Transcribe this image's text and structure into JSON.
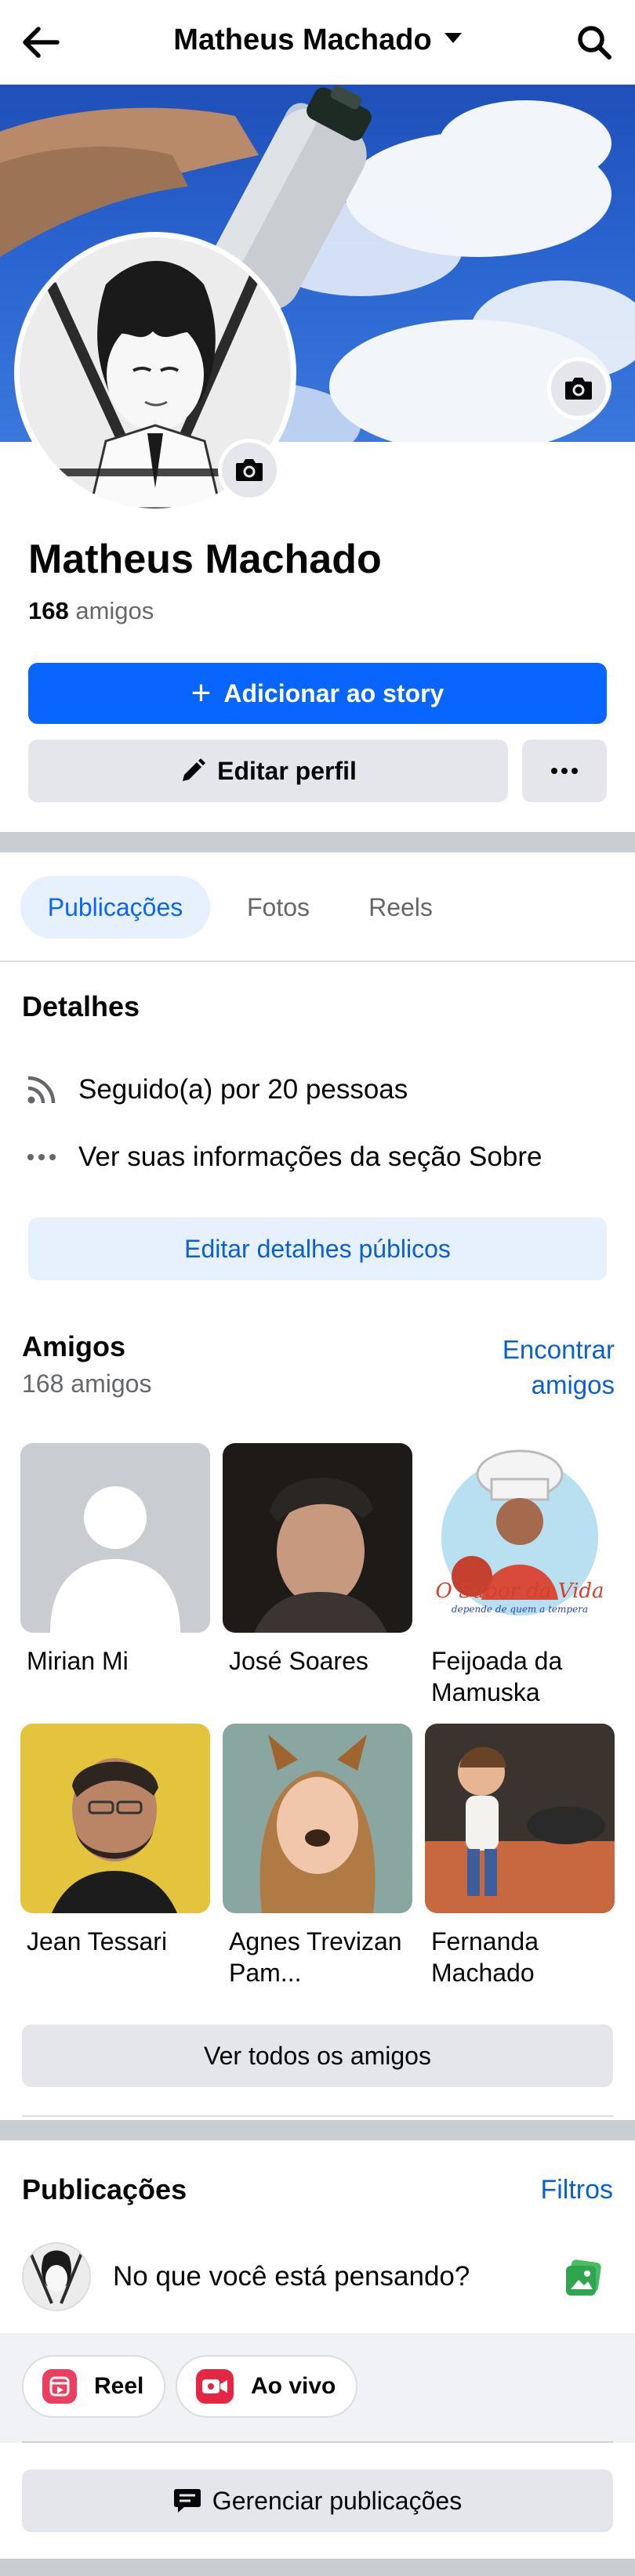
{
  "header": {
    "title": "Matheus Machado",
    "back_icon": "arrow-left-icon",
    "search_icon": "search-icon"
  },
  "profile": {
    "name": "Matheus Machado",
    "friends_number": "168",
    "friends_word": "amigos",
    "add_story_label": "Adicionar ao story",
    "edit_profile_label": "Editar perfil"
  },
  "tabs": [
    {
      "label": "Publicações",
      "active": true
    },
    {
      "label": "Fotos",
      "active": false
    },
    {
      "label": "Reels",
      "active": false
    }
  ],
  "details": {
    "heading": "Detalhes",
    "followed_by": "Seguido(a) por 20 pessoas",
    "about_info": "Ver suas informações da seção Sobre",
    "edit_details_label": "Editar detalhes públicos"
  },
  "friends": {
    "heading": "Amigos",
    "count_label": "168 amigos",
    "find_label": "Encontrar amigos",
    "see_all_label": "Ver todos os amigos",
    "list": [
      {
        "name": "Mirian Mi"
      },
      {
        "name": "José Soares"
      },
      {
        "name": "Feijoada da Mamuska"
      },
      {
        "name": "Jean Tessari"
      },
      {
        "name": "Agnes Trevizan Pam..."
      },
      {
        "name": "Fernanda Machado"
      }
    ]
  },
  "posts": {
    "heading": "Publicações",
    "filters_label": "Filtros",
    "composer_placeholder": "No que você está pensando?",
    "reel_label": "Reel",
    "live_label": "Ao vivo",
    "manage_label": "Gerenciar publicações"
  },
  "logo_text": {
    "line1": "O Sabor da Vida",
    "line2": "depende de quem a tempera"
  },
  "colors": {
    "primary": "#0866ff",
    "link": "#0a5fd1",
    "secondary_button": "#e4e6eb",
    "tab_active_bg": "#e7f0fd",
    "separator": "#c9ccd1",
    "muted_text": "#65676b"
  }
}
